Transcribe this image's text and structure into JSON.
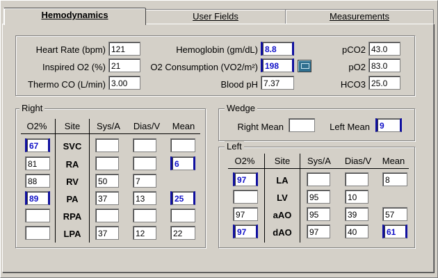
{
  "tabs": [
    "Hemodynamics",
    "User Fields",
    "Measurements"
  ],
  "top": {
    "heart_rate": {
      "label": "Heart Rate (bpm)",
      "value": "121"
    },
    "inspired_o2": {
      "label": "Inspired O2 (%)",
      "value": "21"
    },
    "thermo_co": {
      "label": "Thermo CO (L/min)",
      "value": "3.00"
    },
    "hemoglobin": {
      "label": "Hemoglobin (gm/dL)",
      "value": "8.8"
    },
    "o2_consumption": {
      "label": "O2 Consumption (VO2/m²)",
      "value": "198"
    },
    "blood_ph": {
      "label": "Blood pH",
      "value": "7.37"
    },
    "pco2": {
      "label": "pCO2",
      "value": "43.0"
    },
    "po2": {
      "label": "pO2",
      "value": "83.0"
    },
    "hco3": {
      "label": "HCO3",
      "value": "25.0"
    }
  },
  "right": {
    "title": "Right",
    "headers": [
      "O2%",
      "Site",
      "Sys/A",
      "Dias/V",
      "Mean"
    ],
    "rows": [
      {
        "o2": "67",
        "site": "SVC",
        "sys": "",
        "dias": "",
        "mean": ""
      },
      {
        "o2": "81",
        "site": "RA",
        "sys": "",
        "dias": "",
        "mean": "6"
      },
      {
        "o2": "88",
        "site": "RV",
        "sys": "50",
        "dias": "7",
        "mean": ""
      },
      {
        "o2": "89",
        "site": "PA",
        "sys": "37",
        "dias": "13",
        "mean": "25"
      },
      {
        "o2": "",
        "site": "RPA",
        "sys": "",
        "dias": "",
        "mean": ""
      },
      {
        "o2": "",
        "site": "LPA",
        "sys": "37",
        "dias": "12",
        "mean": "22"
      }
    ]
  },
  "wedge": {
    "title": "Wedge",
    "right_mean_label": "Right Mean",
    "right_mean": "",
    "left_mean_label": "Left Mean",
    "left_mean": "9"
  },
  "left": {
    "title": "Left",
    "headers": [
      "O2%",
      "Site",
      "Sys/A",
      "Dias/V",
      "Mean"
    ],
    "rows": [
      {
        "o2": "97",
        "site": "LA",
        "sys": "",
        "dias": "",
        "mean": "8"
      },
      {
        "o2": "",
        "site": "LV",
        "sys": "95",
        "dias": "10",
        "mean": ""
      },
      {
        "o2": "97",
        "site": "aAO",
        "sys": "95",
        "dias": "39",
        "mean": "57"
      },
      {
        "o2": "97",
        "site": "dAO",
        "sys": "97",
        "dias": "40",
        "mean": "61"
      }
    ]
  },
  "colors": {
    "highlight_text": "#1010c8",
    "highlight_border": "#1010a0",
    "bg": "#d4d0c8"
  }
}
